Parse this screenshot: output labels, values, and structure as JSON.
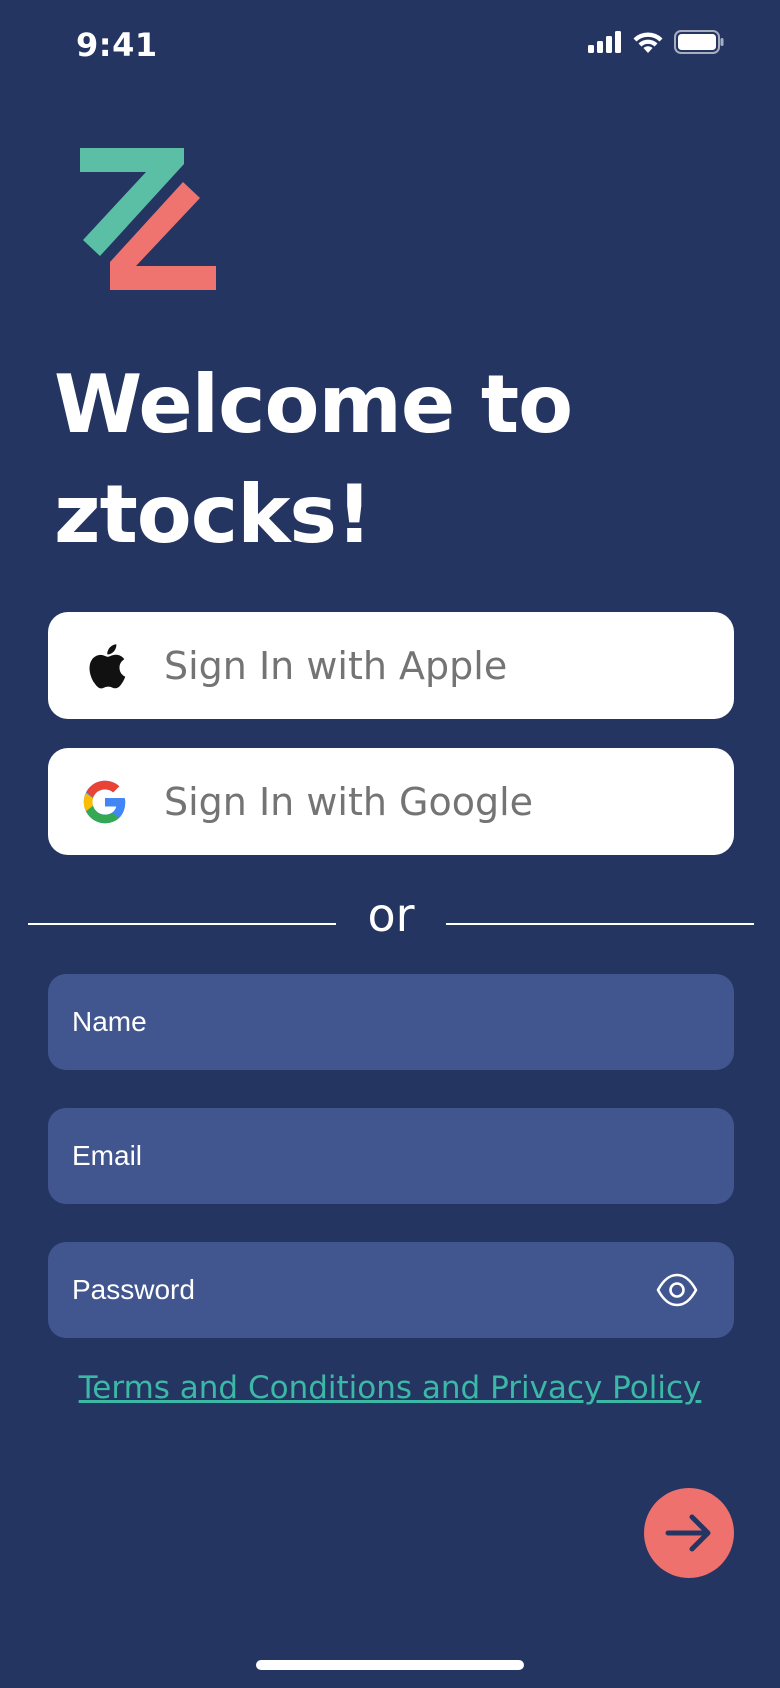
{
  "status_bar": {
    "time": "9:41"
  },
  "brand": {
    "logo": "ztocks-z-logo",
    "colors": {
      "background": "#253561",
      "logo_top": "#5bbfa6",
      "logo_bottom": "#ef736f",
      "field": "#41568f",
      "link": "#3bb8a6",
      "next_button": "#ef716e"
    }
  },
  "welcome": {
    "line1": "Welcome to",
    "line2": "ztocks!"
  },
  "social": {
    "apple": {
      "label": "Sign In with Apple",
      "icon": "apple-icon"
    },
    "google": {
      "label": "Sign In with Google",
      "icon": "google-icon"
    }
  },
  "divider": {
    "text": "or"
  },
  "form": {
    "name": {
      "placeholder": "Name",
      "value": ""
    },
    "email": {
      "placeholder": "Email",
      "value": ""
    },
    "password": {
      "placeholder": "Password",
      "value": "",
      "toggle_icon": "eye-icon"
    }
  },
  "terms": {
    "link_text": "Terms and Conditions and Privacy Policy"
  },
  "next": {
    "icon": "arrow-right-icon"
  }
}
